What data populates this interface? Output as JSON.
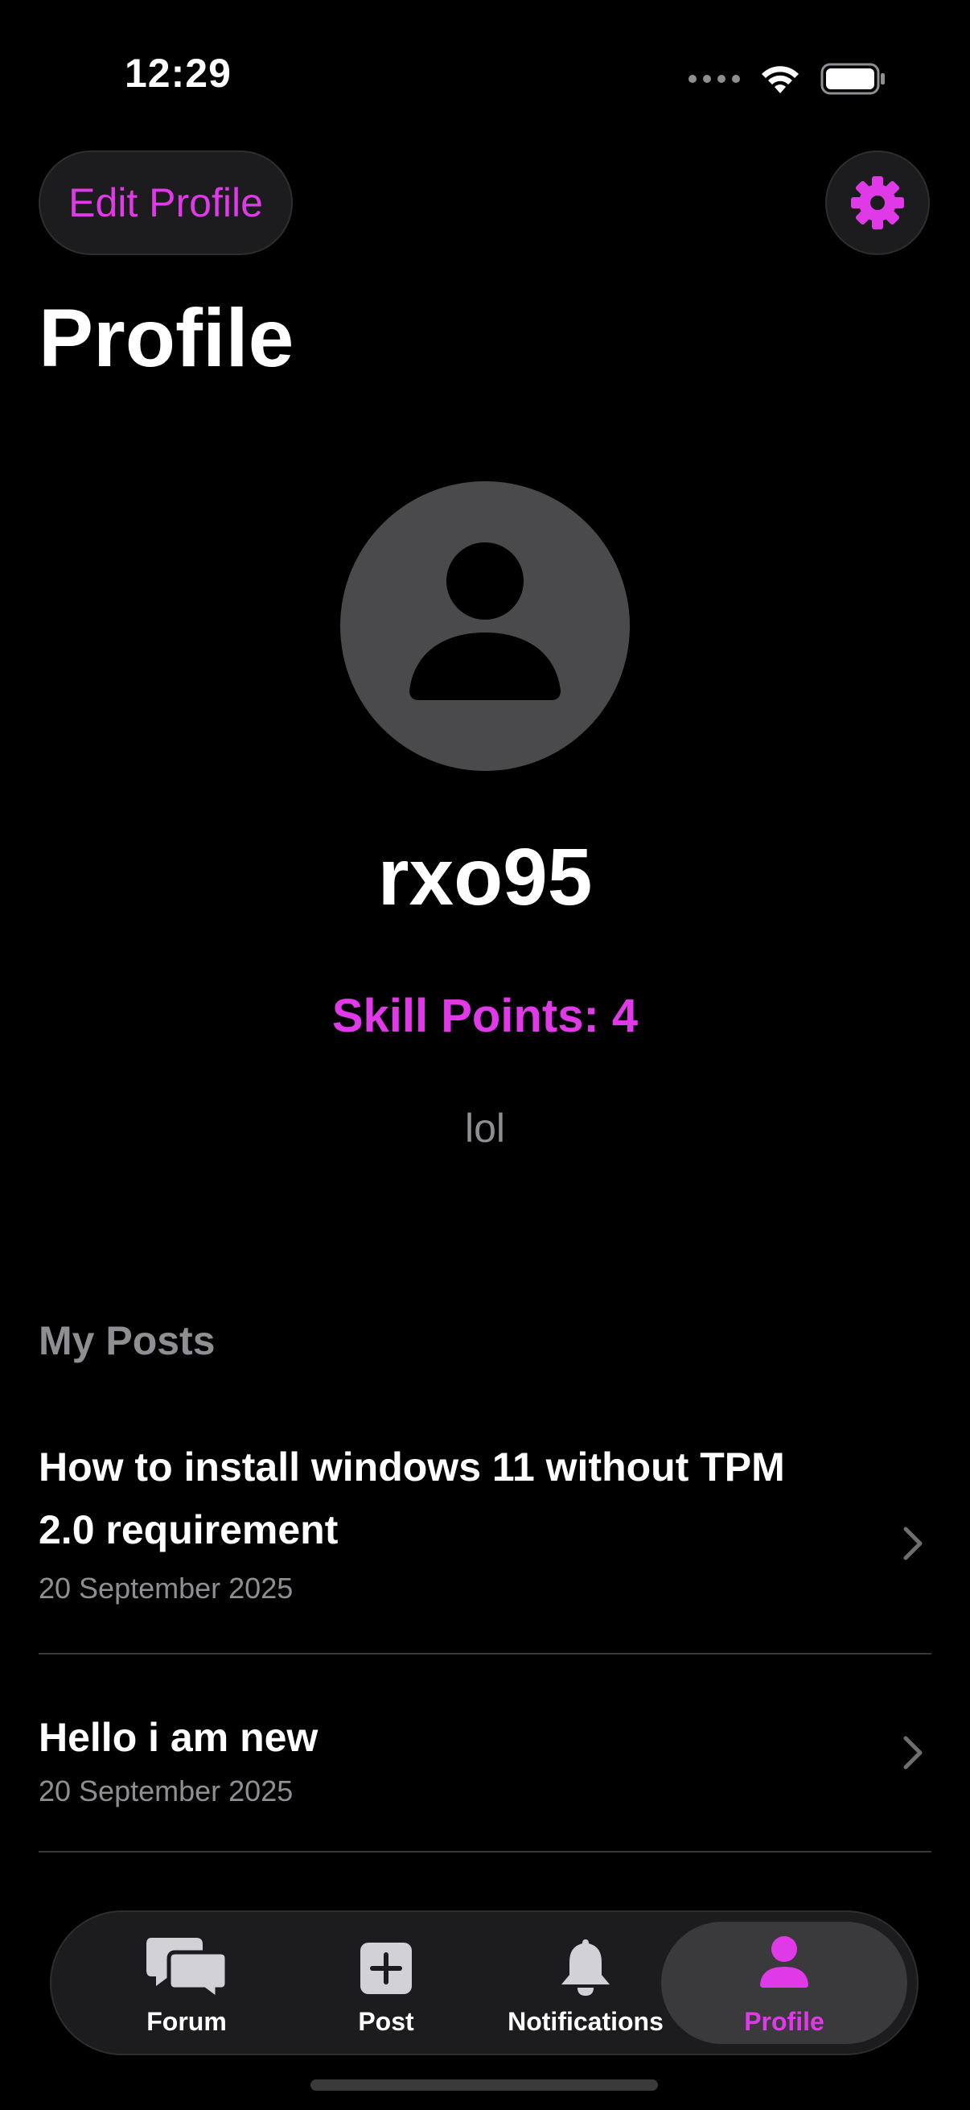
{
  "status_bar": {
    "time": "12:29"
  },
  "header": {
    "edit_profile_label": "Edit Profile",
    "title": "Profile"
  },
  "profile": {
    "username": "rxo95",
    "skill_points": "Skill Points: 4",
    "bio": "lol"
  },
  "posts": {
    "section_title": "My Posts",
    "items": [
      {
        "title": "How to install windows 11 without TPM 2.0 requirement",
        "date": "20 September 2025"
      },
      {
        "title": "Hello i am new",
        "date": "20 September 2025"
      }
    ]
  },
  "tab_bar": {
    "tabs": [
      {
        "label": "Forum",
        "icon": "chat-bubbles-icon",
        "selected": false
      },
      {
        "label": "Post",
        "icon": "plus-square-icon",
        "selected": false
      },
      {
        "label": "Notifications",
        "icon": "bell-icon",
        "selected": false
      },
      {
        "label": "Profile",
        "icon": "person-icon",
        "selected": true
      }
    ]
  },
  "colors": {
    "accent": "#e03ae8",
    "background": "#000000",
    "secondary_text": "#8e8e93",
    "control_background": "#1c1c1e"
  }
}
